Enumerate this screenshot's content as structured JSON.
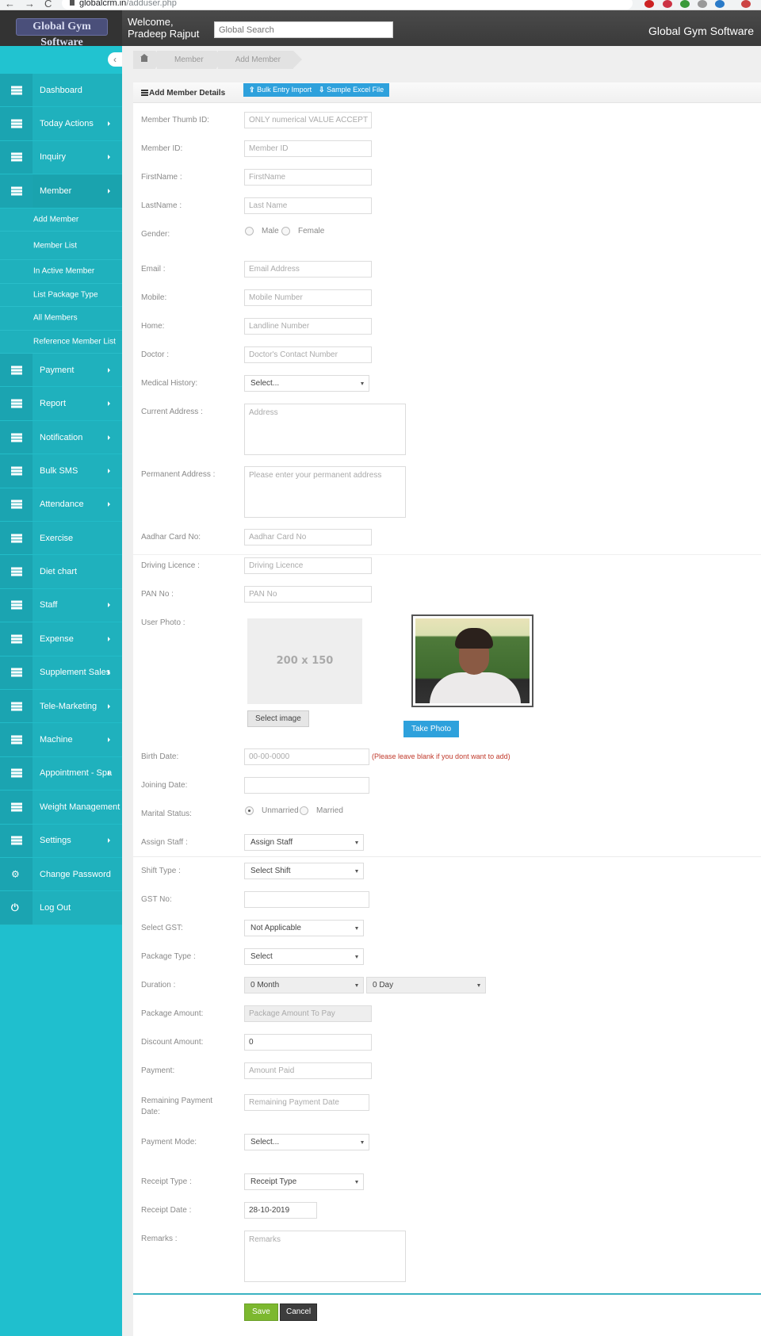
{
  "browser": {
    "url_host": "globalcrm.in",
    "url_path": "/adduser.php"
  },
  "topbar": {
    "logo_text": "Global Gym Software",
    "welcome_line1": "Welcome,",
    "welcome_line2": "Pradeep Rajput",
    "search_placeholder": "Global Search",
    "app_title": "Global Gym Software"
  },
  "sidebar": {
    "items": [
      {
        "label": "Dashboard",
        "icon": "menu-icon",
        "has_submenu": false
      },
      {
        "label": "Today Actions",
        "icon": "menu-icon",
        "has_submenu": true
      },
      {
        "label": "Inquiry",
        "icon": "menu-icon",
        "has_submenu": true
      },
      {
        "label": "Member",
        "icon": "menu-icon",
        "has_submenu": true,
        "active": true
      },
      {
        "label": "Payment",
        "icon": "menu-icon",
        "has_submenu": true
      },
      {
        "label": "Report",
        "icon": "menu-icon",
        "has_submenu": true
      },
      {
        "label": "Notification",
        "icon": "menu-icon",
        "has_submenu": true
      },
      {
        "label": "Bulk SMS",
        "icon": "menu-icon",
        "has_submenu": true
      },
      {
        "label": "Attendance",
        "icon": "menu-icon",
        "has_submenu": true
      },
      {
        "label": "Exercise",
        "icon": "menu-icon",
        "has_submenu": false
      },
      {
        "label": "Diet chart",
        "icon": "menu-icon",
        "has_submenu": false
      },
      {
        "label": "Staff",
        "icon": "menu-icon",
        "has_submenu": true
      },
      {
        "label": "Expense",
        "icon": "menu-icon",
        "has_submenu": true
      },
      {
        "label": "Supplement Sales",
        "icon": "menu-icon",
        "has_submenu": true
      },
      {
        "label": "Tele-Marketing",
        "icon": "menu-icon",
        "has_submenu": true
      },
      {
        "label": "Machine",
        "icon": "menu-icon",
        "has_submenu": true
      },
      {
        "label": "Appointment - Spa",
        "icon": "menu-icon",
        "has_submenu": true
      },
      {
        "label": "Weight Management",
        "icon": "menu-icon",
        "has_submenu": false
      },
      {
        "label": "Settings",
        "icon": "menu-icon",
        "has_submenu": true
      },
      {
        "label": "Change Password",
        "icon": "gears-icon",
        "has_submenu": false
      },
      {
        "label": "Log Out",
        "icon": "power-icon",
        "has_submenu": false
      }
    ],
    "member_submenu": [
      "Add Member",
      "Member List",
      "In Active Member",
      "List Package Type",
      "All Members",
      "Reference Member List"
    ]
  },
  "breadcrumb": {
    "home_icon": "home-icon",
    "items": [
      "Member",
      "Add Member"
    ]
  },
  "panel": {
    "title": "Add Member Details",
    "bulk_import_label": "Bulk Entry Import",
    "sample_excel_label": "Sample Excel File"
  },
  "form": {
    "thumb_id": {
      "label": "Member Thumb ID:",
      "placeholder": "ONLY numerical VALUE ACCEPT",
      "value": ""
    },
    "member_id": {
      "label": "Member ID:",
      "placeholder": "Member ID",
      "value": ""
    },
    "first_name": {
      "label": "FirstName :",
      "placeholder": "FirstName",
      "value": ""
    },
    "last_name": {
      "label": "LastName :",
      "placeholder": "Last Name",
      "value": ""
    },
    "gender": {
      "label": "Gender:",
      "options": [
        "Male",
        "Female"
      ],
      "selected": null
    },
    "email": {
      "label": "Email :",
      "placeholder": "Email Address",
      "value": ""
    },
    "mobile": {
      "label": "Mobile:",
      "placeholder": "Mobile Number",
      "value": ""
    },
    "home": {
      "label": "Home:",
      "placeholder": "Landline Number",
      "value": ""
    },
    "doctor": {
      "label": "Doctor :",
      "placeholder": "Doctor's Contact Number",
      "value": ""
    },
    "medical_history": {
      "label": "Medical History:",
      "selected": "Select..."
    },
    "current_address": {
      "label": "Current Address :",
      "placeholder": "Address",
      "value": ""
    },
    "permanent_address": {
      "label": "Permanent Address :",
      "placeholder": "Please enter your permanent address",
      "value": ""
    },
    "aadhar": {
      "label": "Aadhar Card No:",
      "placeholder": "Aadhar Card No",
      "value": ""
    },
    "driving_licence": {
      "label": "Driving Licence :",
      "placeholder": "Driving Licence",
      "value": ""
    },
    "pan": {
      "label": "PAN No :",
      "placeholder": "PAN No",
      "value": ""
    },
    "user_photo": {
      "label": "User Photo :",
      "placeholder_text": "200 x 150",
      "select_button": "Select image",
      "take_photo_button": "Take Photo"
    },
    "birth_date": {
      "label": "Birth Date:",
      "placeholder": "00-00-0000",
      "value": "",
      "hint": "(Please leave blank if you dont want to add)"
    },
    "joining_date": {
      "label": "Joining Date:",
      "value": ""
    },
    "marital_status": {
      "label": "Marital Status:",
      "options": [
        "Unmarried",
        "Married"
      ],
      "selected": "Unmarried"
    },
    "assign_staff": {
      "label": "Assign Staff :",
      "selected": "Assign Staff"
    },
    "shift_type": {
      "label": "Shift Type :",
      "selected": "Select Shift"
    },
    "gst_no": {
      "label": "GST No:",
      "value": ""
    },
    "select_gst": {
      "label": "Select GST:",
      "selected": "Not Applicable"
    },
    "package_type": {
      "label": "Package Type :",
      "selected": "Select"
    },
    "duration": {
      "label": "Duration :",
      "months_selected": "0 Month",
      "days_selected": "0 Day"
    },
    "package_amount": {
      "label": "Package Amount:",
      "placeholder": "Package Amount To Pay",
      "value": ""
    },
    "discount_amount": {
      "label": "Discount Amount:",
      "value": "0"
    },
    "payment": {
      "label": "Payment:",
      "placeholder": "Amount Paid",
      "value": ""
    },
    "remaining_payment_date": {
      "label_line1": "Remaining Payment",
      "label_line2": "Date:",
      "placeholder": "Remaining Payment Date",
      "value": ""
    },
    "payment_mode": {
      "label": "Payment Mode:",
      "selected": "Select..."
    },
    "receipt_type": {
      "label": "Receipt Type :",
      "selected": "Receipt Type"
    },
    "receipt_date": {
      "label": "Receipt Date :",
      "value": "28-10-2019"
    },
    "remarks": {
      "label": "Remarks :",
      "placeholder": "Remarks",
      "value": ""
    }
  },
  "actions": {
    "save_label": "Save",
    "cancel_label": "Cancel"
  }
}
